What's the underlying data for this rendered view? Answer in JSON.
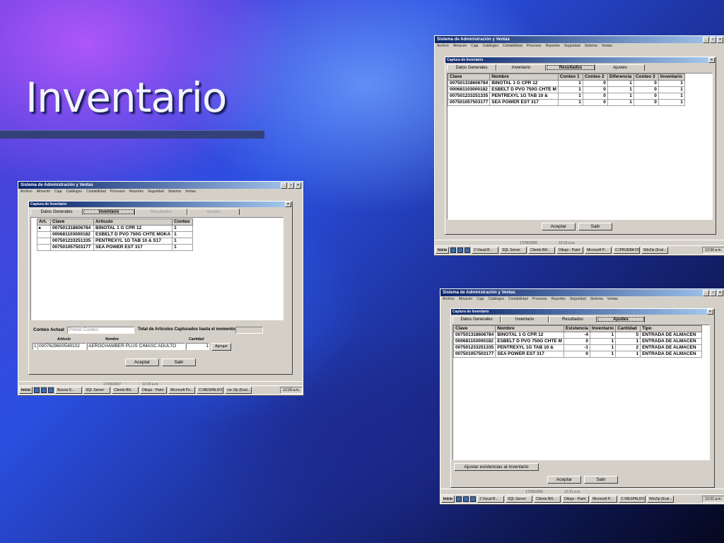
{
  "slide": {
    "title": "Inventario"
  },
  "app": {
    "title": "Sistema de Administración y Ventas",
    "menu": [
      "Archivo",
      "Almacén",
      "Caja",
      "Catálogos",
      "Contabilidad",
      "Procesos",
      "Reportes",
      "Seguridad",
      "Sistema",
      "Ventas"
    ],
    "dialog_title": "Captura de Inventario",
    "ok_label": "Aceptar",
    "exit_label": "Salir",
    "start_label": "Inicio"
  },
  "shot1": {
    "tabs": [
      "Datos Generales",
      "Inventario",
      "Resultados",
      "Ajustes"
    ],
    "columns": [
      "Art.",
      "Clave",
      "Artículo",
      "Conteo"
    ],
    "rows": [
      [
        "007501318606784",
        "BINOTAL 1 G CPR 12",
        "1"
      ],
      [
        "000681103000182",
        "ESBELT D PVO 750G CHTE MOKA",
        "1"
      ],
      [
        "007501233251335",
        "PENTREXYL 1G TAB 10   & S17",
        "1"
      ],
      [
        "007501057503177",
        "SEA POWER EST 317",
        "1"
      ]
    ],
    "conteo_label": "Conteo Actual",
    "conteo_value": "Primer Conteo",
    "total_label": "Total de Artículos Capturados hasta el momento",
    "col_articulo": "Artículo",
    "col_nombre": "Nombre",
    "col_cantidad": "Cantidad",
    "entry_index": "1",
    "entry_code": "0007629600549102",
    "entry_name": "AEROCHAMBER PLUS C/MASC ADULTO",
    "entry_qty": "1",
    "add_label": "Agregar",
    "status_date": "17/05/2007",
    "status_time": "12:29 a.m.",
    "taskbar": [
      "Buscar E...",
      "SQL Server",
      "Cliente Bill...",
      "Dibujo - Paint",
      "Microsoft Po...",
      "C:\\RESPALDO",
      "csc Zip (Eval..."
    ],
    "clock": "12:29 a.m."
  },
  "shot2": {
    "tabs": [
      "Datos Generales",
      "Inventario",
      "Resultados",
      "Ajustes"
    ],
    "columns": [
      "Clave",
      "Nombre",
      "Conteo 1",
      "Conteo 2",
      "Diferencia",
      "Conteo 3",
      "Inventario"
    ],
    "rows": [
      [
        "007501318606784",
        "BINOTAL 1 G CPR 12",
        "1",
        "0",
        "1",
        "0",
        "1"
      ],
      [
        "000681103000182",
        "ESBELT D PVO 750G CHTE M",
        "1",
        "0",
        "1",
        "0",
        "1"
      ],
      [
        "007501233251335",
        "PENTREXYL 1G TAB 10      &",
        "1",
        "0",
        "1",
        "0",
        "1"
      ],
      [
        "007501057503177",
        "SEA POWER EST 317",
        "1",
        "0",
        "1",
        "0",
        "1"
      ]
    ],
    "status_date": "17/05/2006",
    "status_time": "12:10 a.m.",
    "taskbar": [
      "2 Visual B...",
      "SQL Server",
      "Cliente Bill...",
      "Dibujo - Paint",
      "Microsoft P...",
      "C:\\PRUEBA DOC",
      "WinZip (Eval..."
    ],
    "clock": "12:30 a.m."
  },
  "shot3": {
    "tabs": [
      "Datos Generales",
      "Inventario",
      "Resultados",
      "Ajustes"
    ],
    "columns": [
      "Clave",
      "Nombre",
      "Existencia",
      "Inventario",
      "Cantidad",
      "Tipo"
    ],
    "rows": [
      [
        "007501318606784",
        "BINOTAL 1 G CPR 12",
        "-4",
        "1",
        "5",
        "ENTRADA DE ALMACEN"
      ],
      [
        "000681103000182",
        "ESBELT D PVO 750G CHTE M",
        "0",
        "1",
        "1",
        "ENTRADA DE ALMACEN"
      ],
      [
        "007501233251335",
        "PENTREXYL 1G TAB 10      &",
        "-1",
        "1",
        "2",
        "ENTRADA DE ALMACEN"
      ],
      [
        "007501057503177",
        "SEA POWER EST 317",
        "0",
        "1",
        "1",
        "ENTRADA DE ALMACEN"
      ]
    ],
    "adjust_label": "Ajustar existencias al inventario",
    "status_date": "17/05/2006",
    "status_time": "12:31 a.m.",
    "taskbar": [
      "2 Visual B...",
      "SQL Server",
      "Cliente Bill...",
      "Dibujo - Paint",
      "Microsoft P...",
      "C:\\RESPALDO",
      "WinZip (Eval..."
    ],
    "clock": "12:31 a.m."
  }
}
